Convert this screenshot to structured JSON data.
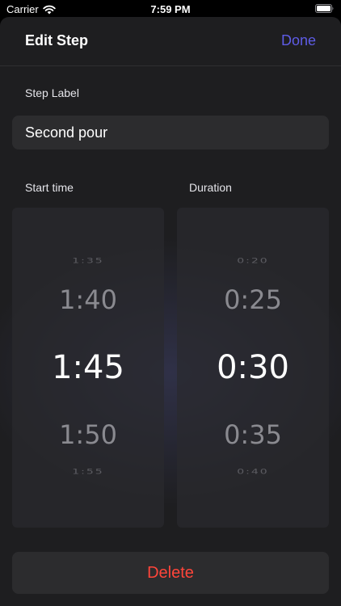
{
  "status_bar": {
    "carrier": "Carrier",
    "time": "7:59 PM",
    "icons": [
      "wifi-icon",
      "battery-icon"
    ]
  },
  "nav": {
    "title": "Edit Step",
    "done_label": "Done"
  },
  "step_label": {
    "label": "Step Label",
    "value": "Second pour"
  },
  "start_time": {
    "label": "Start time",
    "options": [
      "1:35",
      "1:40",
      "1:45",
      "1:50",
      "1:55"
    ],
    "selected": "1:45"
  },
  "duration": {
    "label": "Duration",
    "options": [
      "0:20",
      "0:25",
      "0:30",
      "0:35",
      "0:40"
    ],
    "selected": "0:30"
  },
  "delete_label": "Delete",
  "colors": {
    "accent": "#5e5ce6",
    "destructive": "#ff453a",
    "sheet_background": "#1e1e20",
    "field_background": "#2c2c2e"
  }
}
